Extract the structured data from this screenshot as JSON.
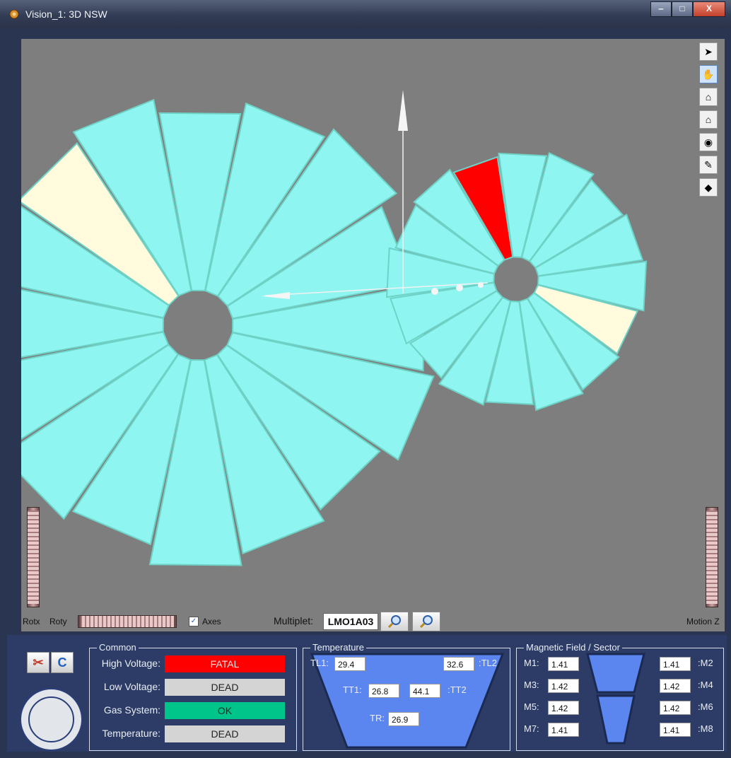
{
  "window": {
    "title": "Vision_1: 3D NSW",
    "controls": {
      "minimize": "‒",
      "maximize": "□",
      "close": "X"
    }
  },
  "viewport": {
    "background": "#7e7e7e",
    "sector_color": "#8ff5f0",
    "fatal_color": "#ff0000",
    "warning_color": "#fffbdc",
    "toolbar": [
      {
        "id": "select",
        "icon": "arrow-pointer-icon",
        "glyph": "➤"
      },
      {
        "id": "pan",
        "icon": "hand-icon",
        "glyph": "✋"
      },
      {
        "id": "home",
        "icon": "home-icon",
        "glyph": "⌂"
      },
      {
        "id": "set-home",
        "icon": "set-home-icon",
        "glyph": "⌂"
      },
      {
        "id": "view",
        "icon": "eye-icon",
        "glyph": "◉"
      },
      {
        "id": "light",
        "icon": "flashlight-icon",
        "glyph": "✎"
      },
      {
        "id": "render",
        "icon": "shape-icon",
        "glyph": "◆"
      }
    ],
    "labels": {
      "rotx": "Rotx",
      "roty": "Roty",
      "axes": "Axes",
      "motion_z": "Motion Z",
      "multiplet": "Multiplet:"
    },
    "multiplet_value": "LMO1A03",
    "axes_checked": "✓"
  },
  "common": {
    "title": "Common",
    "rows": [
      {
        "label": "High Voltage:",
        "value": "FATAL",
        "state": "fatal"
      },
      {
        "label": "Low Voltage:",
        "value": "DEAD",
        "state": "dead"
      },
      {
        "label": "Gas System:",
        "value": "OK",
        "state": "ok"
      },
      {
        "label": "Temperature:",
        "value": "DEAD",
        "state": "dead"
      }
    ]
  },
  "temperature": {
    "title": "Temperature",
    "tl1_label": "TL1:",
    "tl1": "29.4",
    "tl2_label": ":TL2",
    "tl2": "32.6",
    "tt1_label": "TT1:",
    "tt1": "26.8",
    "tt2_label": ":TT2",
    "tt2": "44.1",
    "tr_label": "TR:",
    "tr": "26.9"
  },
  "magnetic": {
    "title": "Magnetic Field / Sector",
    "left": [
      {
        "label": "M1:",
        "value": "1.41"
      },
      {
        "label": "M3:",
        "value": "1.42"
      },
      {
        "label": "M5:",
        "value": "1.42"
      },
      {
        "label": "M7:",
        "value": "1.41"
      }
    ],
    "right": [
      {
        "label": ":M2",
        "value": "1.41"
      },
      {
        "label": ":M4",
        "value": "1.42"
      },
      {
        "label": ":M6",
        "value": "1.42"
      },
      {
        "label": ":M8",
        "value": "1.41"
      }
    ]
  }
}
